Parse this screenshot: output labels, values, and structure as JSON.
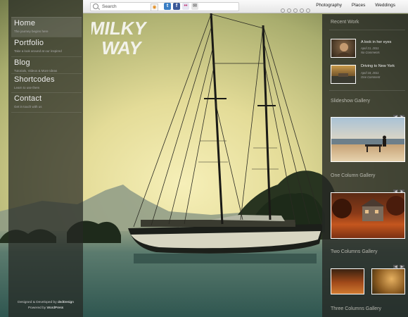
{
  "topbar": {
    "search_placeholder": "Search",
    "nav": [
      "Photography",
      "Places",
      "Weddings"
    ]
  },
  "logo": {
    "line1": "MILKY",
    "line2": "WAY"
  },
  "menu": [
    {
      "title": "Home",
      "subtitle": "The journey begins here"
    },
    {
      "title": "Portfolio",
      "subtitle": "Take a look around at our inspired"
    },
    {
      "title": "Blog",
      "subtitle": "Tutorials, Videos & More Ideas"
    },
    {
      "title": "Shortcodes",
      "subtitle": "Learn to use them"
    },
    {
      "title": "Contact",
      "subtitle": "Get in touch with us"
    }
  ],
  "footer": {
    "designed_prefix": "Designed & Developed by ",
    "designed_by": "dedDesign",
    "powered_prefix": "Powered by ",
    "powered_by": "WordPress"
  },
  "sidebar": {
    "recent_work_title": "Recent Work",
    "recent_work": [
      {
        "title": "A look in her eyes",
        "date": "April 21, 2011",
        "comments": "No Comments"
      },
      {
        "title": "Driving to New York",
        "date": "April 18, 2011",
        "comments": "One Comment"
      }
    ],
    "slideshow_title": "Slideshow Gallery",
    "one_column_title": "One Column Gallery",
    "two_columns_title": "Two Columns Gallery",
    "three_columns_title": "Three Columns Gallery"
  },
  "colors": {
    "sky_top": "#7f8a5a",
    "sky_glow": "#f2e7a6",
    "water": "#3f6a62",
    "panel": "#262824"
  }
}
